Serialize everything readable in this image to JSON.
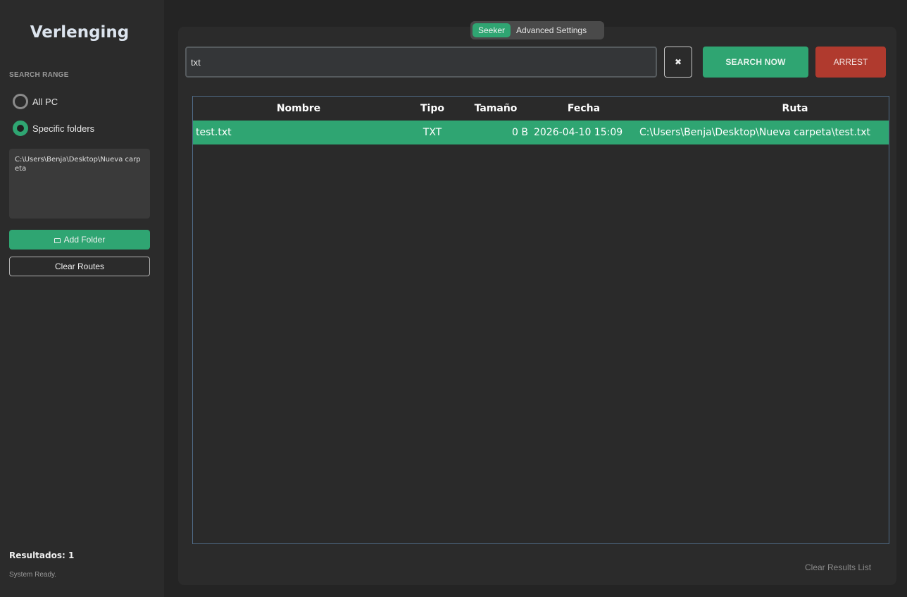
{
  "colors": {
    "accent": "#2fa572",
    "danger": "#b03a2e",
    "background": "#242424",
    "panel": "#2b2b2b"
  },
  "sidebar": {
    "title": "Verlenging",
    "search_range_label": "SEARCH RANGE",
    "options": [
      {
        "label": "All PC",
        "selected": false
      },
      {
        "label": "Specific folders",
        "selected": true
      }
    ],
    "folders_text": "C:\\Users\\Benja\\Desktop\\Nueva carpeta",
    "add_folder_icon": "folder-icon",
    "add_folder_label": "Add Folder",
    "clear_routes_label": "Clear Routes",
    "results_label": "Resultados: 1",
    "status": "System Ready."
  },
  "tabs": [
    {
      "label": "Seeker",
      "active": true
    },
    {
      "label": "Advanced Settings",
      "active": false
    }
  ],
  "search": {
    "value": "txt",
    "clear_icon": "✖",
    "search_label": "SEARCH NOW",
    "stop_label": "ARREST"
  },
  "table": {
    "columns": [
      "Nombre",
      "Tipo",
      "Tamaño",
      "Fecha",
      "Ruta"
    ],
    "rows": [
      {
        "name": "test.txt",
        "type": "TXT",
        "size": "0 B",
        "date": "2026-04-10 15:09",
        "path": "C:\\Users\\Benja\\Desktop\\Nueva carpeta\\test.txt",
        "selected": true
      }
    ]
  },
  "clear_results_label": "Clear Results List"
}
